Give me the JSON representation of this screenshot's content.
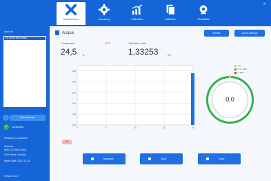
{
  "toolbar": {
    "tabs": [
      {
        "label": "Measurement",
        "icon": "measurement-x-icon",
        "active": true
      },
      {
        "label": "Accessory",
        "icon": "gear-icon",
        "active": false
      },
      {
        "label": "Calibration",
        "icon": "chart-icon",
        "active": false
      },
      {
        "label": "DataFiles",
        "icon": "data-files-icon",
        "active": false
      },
      {
        "label": "CloudData",
        "icon": "cloud-icon",
        "active": false
      }
    ],
    "close": "x"
  },
  "sidebar": {
    "list_label": "User list",
    "selected_user": "Kill for the best Admin",
    "user_button": "Close the user",
    "connected": "Connected",
    "rs_label": "Reading to parameter",
    "serial_label": "Serial Nr.",
    "serial_value": "ABC01 02000 00001",
    "cal_label": "Cool Name: Solution",
    "install_label": "Install Date: 2021-12-16",
    "version_label": "Version 1.0.0"
  },
  "page": {
    "title": "Acqua",
    "btn_left": "Details",
    "btn_right": "Quick Settings",
    "temp_label": "Temperature",
    "temp_target": "25 °C",
    "temp_value": "24,5",
    "temp_unit": "°C",
    "ri_label": "Refractive Index",
    "ri_value": "1,33253",
    "ri_unit": "nD",
    "gauge_value": "0.0",
    "flag": "Stb"
  },
  "legend": [
    {
      "label": "0.0",
      "color": "#f0d020"
    },
    {
      "label": "0.1 - 99.9",
      "color": "#2bb34a"
    },
    {
      "label": "> 99.9",
      "color": "#e53935"
    }
  ],
  "chart_data": {
    "type": "bar",
    "categories": [
      "0",
      "5",
      "10",
      "15",
      "20"
    ],
    "y_ticks": [
      "0.00",
      "1.00",
      "2.00",
      "3.00",
      "4.00",
      "5.00"
    ],
    "ylim": [
      0,
      5.5
    ],
    "bar_x": 20,
    "bar_value": 4.8,
    "grid": true
  },
  "bottom": {
    "measure": "Measure",
    "stop": "Stop",
    "save": "Save"
  },
  "colors": {
    "primary": "#1565d8",
    "accent": "#1f6fe5",
    "ok_green": "#2bb34a",
    "ring_yellow": "#f0d020"
  }
}
